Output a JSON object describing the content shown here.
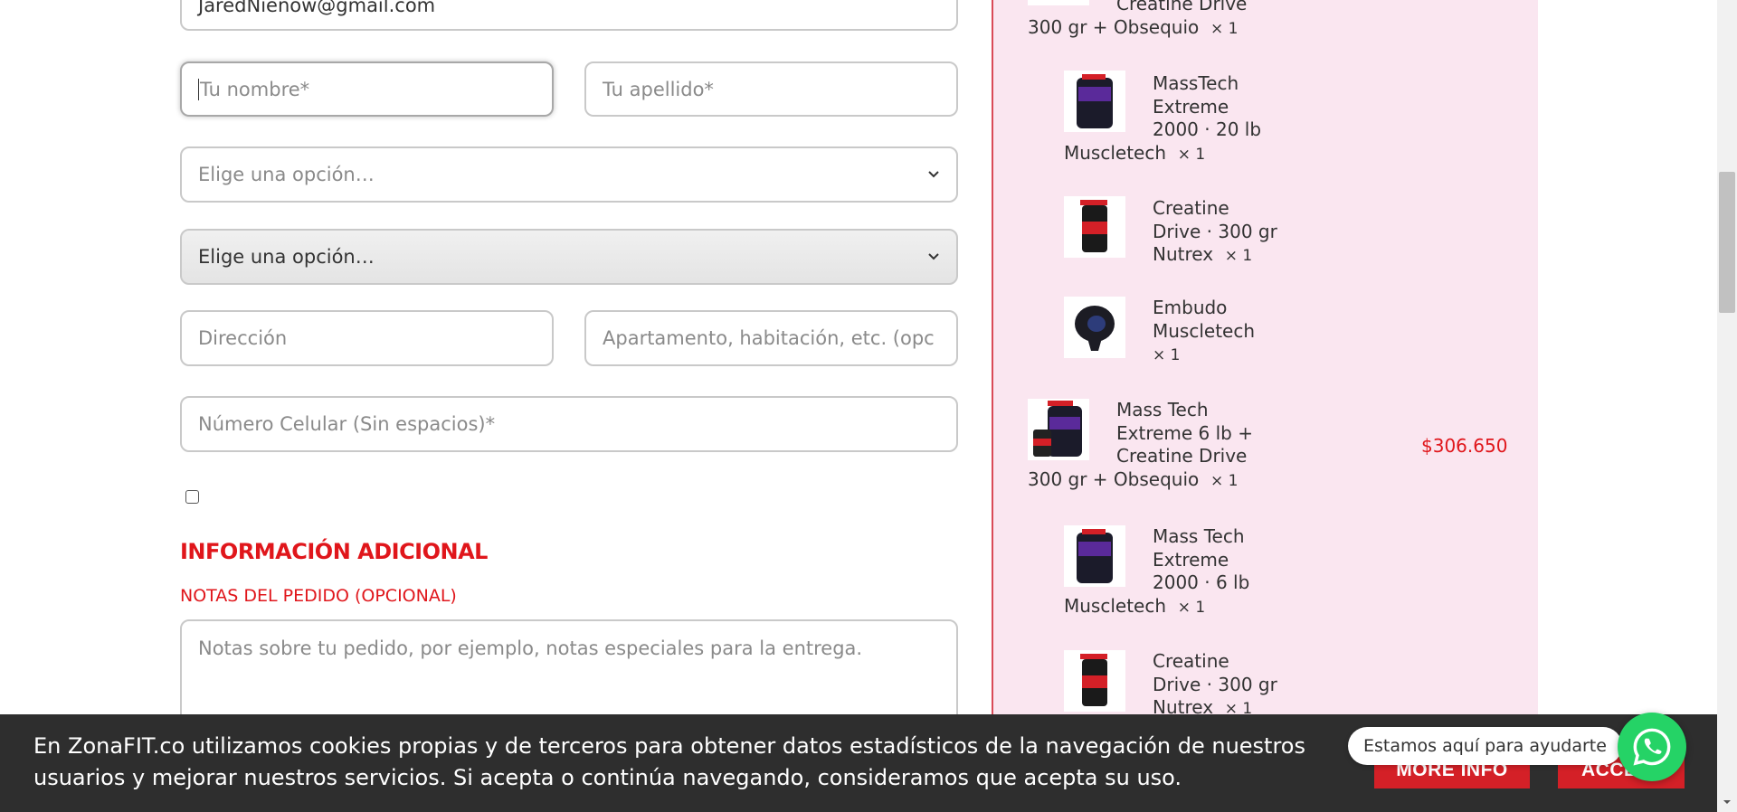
{
  "form": {
    "email_value": "JaredNienow@gmail.com",
    "first_name_placeholder": "Tu nombre*",
    "last_name_placeholder": "Tu apellido*",
    "select1_value": "Elige una opción…",
    "select2_value": "Elige una opción…",
    "address_placeholder": "Dirección",
    "address2_placeholder": "Apartamento, habitación, etc. (opc",
    "phone_placeholder": "Número Celular (Sin espacios)*",
    "checkbox_checked": false,
    "section_title": "INFORMACIÓN ADICIONAL",
    "notes_label": "NOTAS DEL PEDIDO (OPCIONAL)",
    "notes_placeholder": "Notas sobre tu pedido, por ejemplo, notas especiales para la entrega."
  },
  "summary": {
    "items": [
      {
        "lines": [
          "Creatine Drive",
          "300 gr + Obsequio"
        ],
        "qty": "× 1"
      },
      {
        "lines": [
          "MassTech",
          "Extreme",
          "2000 · 20 lb",
          "Muscletech"
        ],
        "qty": "× 1",
        "thumb_icon": "masstech-product-icon"
      },
      {
        "lines": [
          "Creatine",
          "Drive · 300 gr",
          "Nutrex"
        ],
        "qty": "× 1",
        "thumb_icon": "creatine-product-icon"
      },
      {
        "lines": [
          "Embudo",
          "Muscletech"
        ],
        "qty": "× 1",
        "thumb_icon": "funnel-product-icon"
      },
      {
        "lines": [
          "Mass Tech",
          "Extreme 6 lb +",
          "Creatine Drive",
          "300 gr + Obsequio"
        ],
        "qty": "× 1",
        "thumb_icon": "bundle-product-icon"
      },
      {
        "lines": [
          "Mass Tech",
          "Extreme",
          "2000 · 6 lb",
          "Muscletech"
        ],
        "qty": "× 1",
        "thumb_icon": "masstech-product-icon"
      },
      {
        "lines": [
          "Creatine",
          "Drive · 300 gr",
          "Nutrex"
        ],
        "qty": "× 1",
        "thumb_icon": "creatine-product-icon"
      }
    ],
    "bundle_price": "$306.650"
  },
  "cookie": {
    "text": "En ZonaFIT.co utilizamos cookies propias y de terceros para obtener datos estadísticos de la navegación de nuestros usuarios y mejorar nuestros servicios. Si acepta o continúa navegando, consideramos que acepta su uso.",
    "more_info_label": "MORE INFO",
    "accept_label": "ACCEPT"
  },
  "whatsapp": {
    "bubble_text": "Estamos aquí para ayudarte"
  },
  "colors": {
    "accent_red": "#e0161b",
    "panel_pink": "#fae6f0",
    "cookie_bg": "#2e2e2e",
    "whatsapp_green": "#25d366"
  }
}
